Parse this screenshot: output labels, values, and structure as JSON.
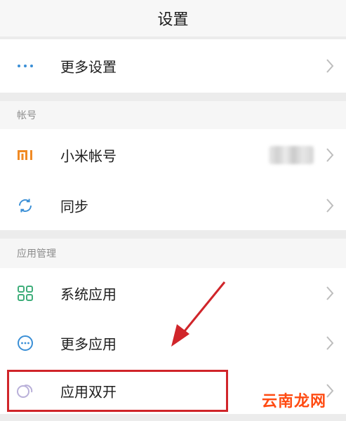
{
  "header": {
    "title": "设置"
  },
  "more_settings": {
    "label": "更多设置",
    "icon": "more-dots-icon"
  },
  "account_section": {
    "title": "帐号",
    "items": [
      {
        "label": "小米帐号",
        "icon": "mi-logo-icon",
        "value_blurred": true
      },
      {
        "label": "同步",
        "icon": "sync-icon"
      }
    ]
  },
  "app_section": {
    "title": "应用管理",
    "items": [
      {
        "label": "系统应用",
        "icon": "grid-apps-icon"
      },
      {
        "label": "更多应用",
        "icon": "more-apps-icon"
      },
      {
        "label": "应用双开",
        "icon": "dual-app-icon",
        "highlighted": true
      }
    ]
  },
  "watermark": "云南龙网",
  "colors": {
    "highlight": "#d0252a",
    "mi_orange": "#f08a24",
    "icon_blue": "#3a8fd6",
    "icon_green": "#3fae7a",
    "watermark": "#ff4b12"
  }
}
